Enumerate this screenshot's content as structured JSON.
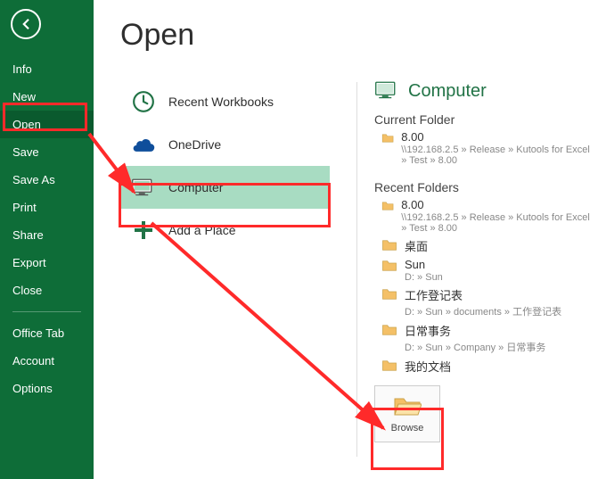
{
  "page_title": "Open",
  "sidebar": {
    "items": [
      {
        "label": "Info"
      },
      {
        "label": "New"
      },
      {
        "label": "Open",
        "active": true
      },
      {
        "label": "Save"
      },
      {
        "label": "Save As"
      },
      {
        "label": "Print"
      },
      {
        "label": "Share"
      },
      {
        "label": "Export"
      },
      {
        "label": "Close"
      }
    ],
    "items2": [
      {
        "label": "Office Tab"
      },
      {
        "label": "Account"
      },
      {
        "label": "Options"
      }
    ]
  },
  "places": {
    "recent": "Recent Workbooks",
    "onedrive": "OneDrive",
    "computer": "Computer",
    "add": "Add a Place"
  },
  "right": {
    "header": "Computer",
    "current_folder_label": "Current Folder",
    "recent_folders_label": "Recent Folders",
    "current_folder": {
      "name": "8.00",
      "path": "\\\\192.168.2.5 » Release » Kutools for Excel » Test » 8.00"
    },
    "recent_folders": [
      {
        "name": "8.00",
        "path": "\\\\192.168.2.5 » Release » Kutools for Excel » Test » 8.00"
      },
      {
        "name": "桌面",
        "path": ""
      },
      {
        "name": "Sun",
        "path": "D: » Sun"
      },
      {
        "name": "工作登记表",
        "path": "D: » Sun » documents » 工作登记表"
      },
      {
        "name": "日常事务",
        "path": "D: » Sun » Company » 日常事务"
      },
      {
        "name": "我的文档",
        "path": ""
      }
    ],
    "browse_label": "Browse"
  }
}
